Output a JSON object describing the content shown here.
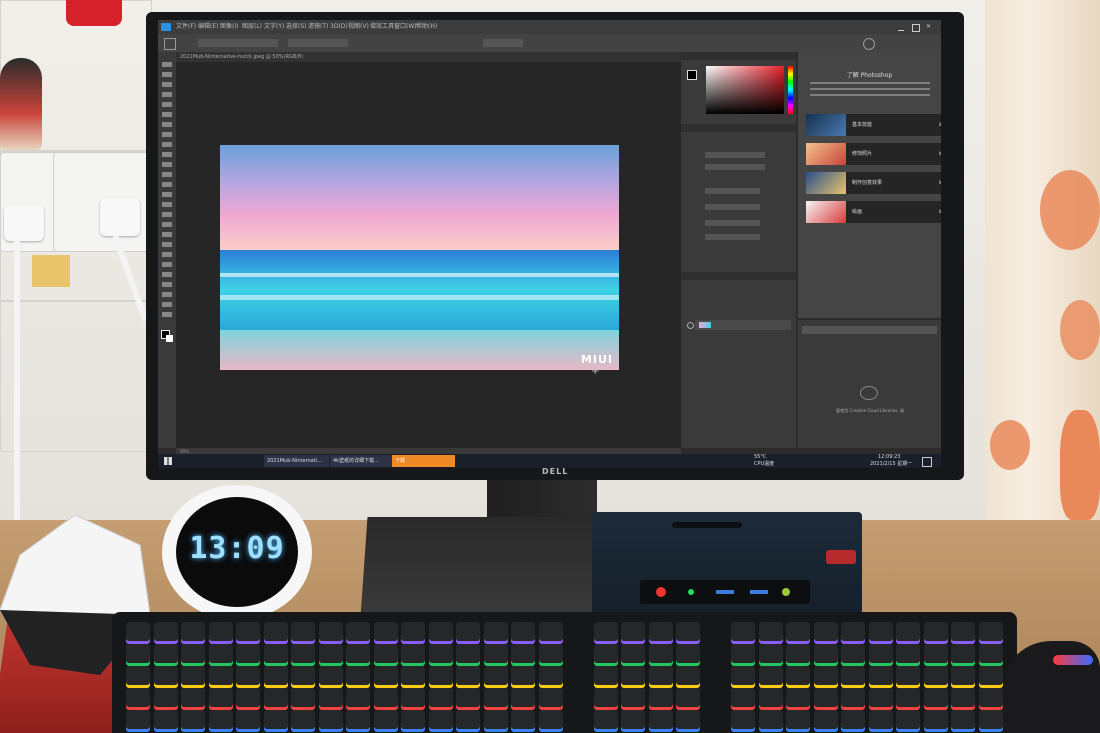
{
  "photo": {
    "monitor_brand": "DELL",
    "clock_time": "13:09"
  },
  "photoshop": {
    "menu_items": [
      "文件(F)",
      "编辑(E)",
      "图像(I)",
      "图层(L)",
      "文字(Y)",
      "选择(S)",
      "滤镜(T)",
      "3D(D)",
      "视图(V)",
      "增效工具",
      "窗口(W)",
      "帮助(H)"
    ],
    "doc_tab": "2021Mub-Ninternative-hutck.jpeg @ 50%(RGB/8)",
    "canvas_watermark": "MIUI",
    "learn_panel": {
      "title": "了解 Photoshop",
      "items": [
        {
          "label": "基本技能"
        },
        {
          "label": "修饰照片"
        },
        {
          "label": "制作创意效果"
        },
        {
          "label": "绘画"
        }
      ]
    },
    "status_zoom": "50%",
    "cc_library_text": "要使用 Creative Cloud Libraries, 请"
  },
  "taskbar": {
    "items": [
      "2021Mub-Ninternati...",
      "4k壁纸的详细下载...",
      "下载"
    ],
    "clock_time": "12:09:23",
    "clock_date": "2021/2/15 星期一",
    "temperature": "55°C",
    "cpu_label": "CPU温度"
  },
  "colors": {
    "ps_dark": "#2b2b2b",
    "taskbar": "#1b1f2a",
    "accent_orange": "#f08a24",
    "clock_led": "#9fdfff"
  }
}
